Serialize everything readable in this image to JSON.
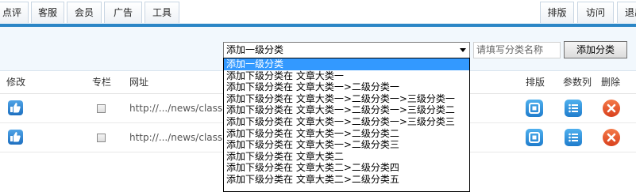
{
  "nav": {
    "tabs": [
      "点评",
      "客服",
      "会员",
      "广告",
      "工具"
    ],
    "right_tabs": [
      "排版",
      "访问",
      "退出"
    ]
  },
  "toolbar": {
    "select_value": "添加一级分类",
    "category_placeholder": "请填写分类名称",
    "add_button": "添加分类"
  },
  "dropdown": {
    "options": [
      "添加一级分类",
      "添加下级分类在 文章大类一",
      "添加下级分类在 文章大类一>二级分类一",
      "添加下级分类在 文章大类一>二级分类一>三级分类一",
      "添加下级分类在 文章大类一>二级分类一>三级分类二",
      "添加下级分类在 文章大类一>二级分类一>三级分类三",
      "添加下级分类在 文章大类一>二级分类二",
      "添加下级分类在 文章大类一>二级分类三",
      "添加下级分类在 文章大类二",
      "添加下级分类在 文章大类二>二级分类四",
      "添加下级分类在 文章大类二>二级分类五"
    ],
    "selected_index": 0
  },
  "table": {
    "headers": {
      "edit": "修改",
      "column": "专栏",
      "url": "网址",
      "layout": "排版",
      "params": "参数列",
      "delete": "删除"
    },
    "rows": [
      {
        "url": "http://.../news/class"
      },
      {
        "url": "http://.../news/class"
      }
    ]
  },
  "colors": {
    "accent": "#2b86c6",
    "toolbar_bg": "#f2f8fd",
    "delete_red": "#e2532a",
    "selected_option": "#3399ff"
  }
}
